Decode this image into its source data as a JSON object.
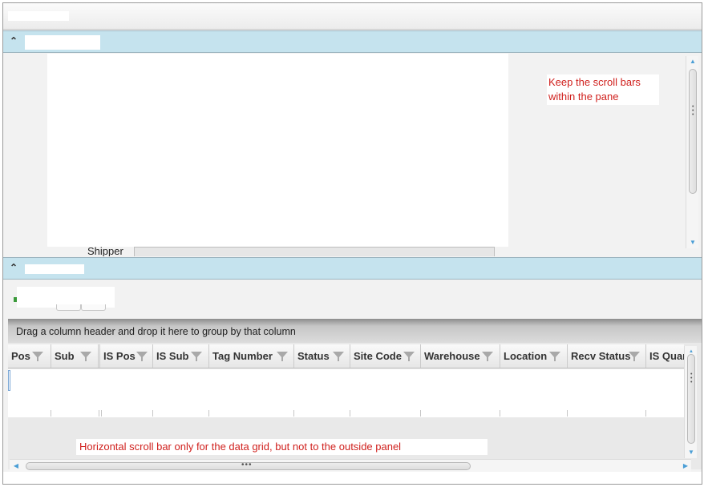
{
  "window": {
    "title": ""
  },
  "top_panel": {
    "header_title": "",
    "collapse_glyph": "⌃",
    "note": "Keep the scroll bars within the pane",
    "shipper_label": "Shipper"
  },
  "bottom_panel": {
    "header_title": "",
    "collapse_glyph": "⌃"
  },
  "grid": {
    "group_panel_text": "Drag a column header and drop it here to group by that column",
    "columns": [
      "Pos",
      "Sub",
      "IS Pos",
      "IS Sub",
      "Tag Number",
      "Status",
      "Site Code",
      "Warehouse",
      "Location",
      "Recv Status",
      "IS Quar"
    ],
    "note": "Horizontal scroll bar only for the data grid, but not to the outside panel"
  },
  "icons": {
    "collapse": "chevron-up-icon",
    "filter": "funnel-icon",
    "scroll_up": "arrow-up-icon",
    "scroll_down": "arrow-down-icon",
    "scroll_left": "arrow-left-icon",
    "scroll_right": "arrow-right-icon"
  },
  "colors": {
    "panel_header": "#c5e3ee",
    "note_text": "#d0201d",
    "scroll_arrow": "#4a9ed6"
  }
}
